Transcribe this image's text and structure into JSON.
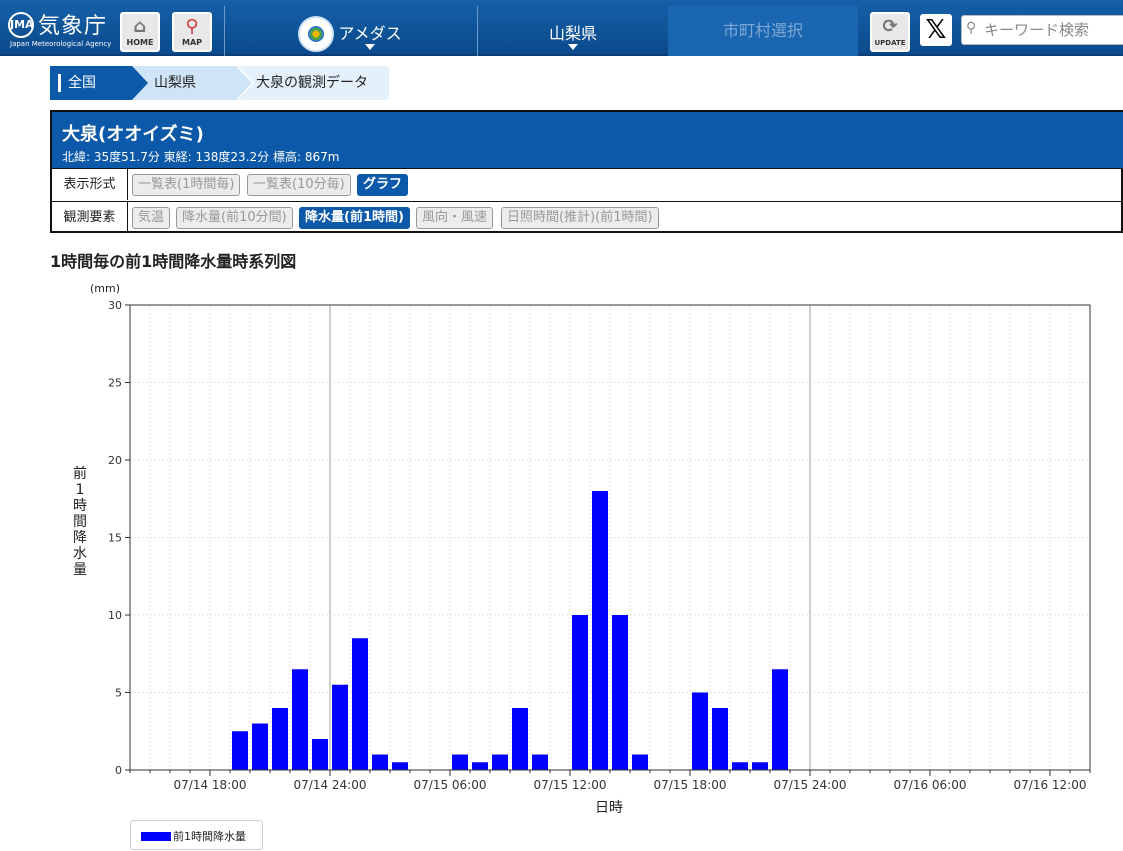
{
  "header": {
    "logo_text": "気象庁",
    "logo_mark": "JMA",
    "logo_en": "Japan Meteorological Agency",
    "home_label": "HOME",
    "home_icon": "home-icon",
    "map_label": "MAP",
    "map_icon": "map-pin-icon",
    "nav_amedas": "アメダス",
    "nav_prefecture": "山梨県",
    "nav_city": "市町村選択",
    "update_label": "UPDATE",
    "update_icon": "refresh-icon",
    "x_label": "𝕏",
    "search_placeholder": "キーワード検索"
  },
  "breadcrumb": [
    "全国",
    "山梨県",
    "大泉の観測データ"
  ],
  "station": {
    "name": "大泉(オオイズミ)",
    "coords": "北緯: 35度51.7分 東経: 138度23.2分 標高: 867m",
    "format_label": "表示形式",
    "formats": [
      "一覧表(1時間毎)",
      "一覧表(10分毎)",
      "グラフ"
    ],
    "active_format": "グラフ",
    "element_label": "観測要素",
    "elements": [
      "気温",
      "降水量(前10分間)",
      "降水量(前1時間)",
      "風向・風速",
      "日照時間(推計)(前1時間)"
    ],
    "active_element": "降水量(前1時間)"
  },
  "chart_title": "1時間毎の前1時間降水量時系列図",
  "chart_data": {
    "type": "bar",
    "title": "1時間毎の前1時間降水量時系列図",
    "xlabel": "日時",
    "ylabel": "前1時間降水量",
    "y_unit": "(mm)",
    "ylim": [
      0,
      30
    ],
    "yticks": [
      0,
      5,
      10,
      15,
      20,
      25,
      30
    ],
    "x_start": "07/14 14:00",
    "x_end": "07/16 14:00",
    "xticks": [
      "07/14 18:00",
      "07/14 24:00",
      "07/15 06:00",
      "07/15 12:00",
      "07/15 18:00",
      "07/15 24:00",
      "07/16 06:00",
      "07/16 12:00"
    ],
    "grid": true,
    "legend_position": "bottom-left",
    "series": [
      {
        "name": "前1時間降水量",
        "color": "#0000ff",
        "times": [
          "07/14 20:00",
          "07/14 21:00",
          "07/14 22:00",
          "07/14 23:00",
          "07/14 24:00",
          "07/15 01:00",
          "07/15 02:00",
          "07/15 03:00",
          "07/15 04:00",
          "07/15 05:00",
          "07/15 06:00",
          "07/15 07:00",
          "07/15 08:00",
          "07/15 09:00",
          "07/15 10:00",
          "07/15 11:00",
          "07/15 12:00",
          "07/15 13:00",
          "07/15 14:00",
          "07/15 15:00",
          "07/15 16:00",
          "07/15 17:00",
          "07/15 18:00",
          "07/15 19:00",
          "07/15 20:00",
          "07/15 21:00",
          "07/15 22:00",
          "07/15 23:00",
          "07/15 24:00"
        ],
        "values": [
          2.5,
          3.0,
          4.0,
          6.5,
          2.0,
          5.5,
          8.5,
          1.0,
          0.5,
          0,
          0,
          1.0,
          0.5,
          1.0,
          4.0,
          1.0,
          0,
          10.0,
          18.0,
          10.0,
          1.0,
          0,
          0,
          5.0,
          4.0,
          0.5,
          0.5,
          6.5,
          0
        ]
      }
    ]
  }
}
